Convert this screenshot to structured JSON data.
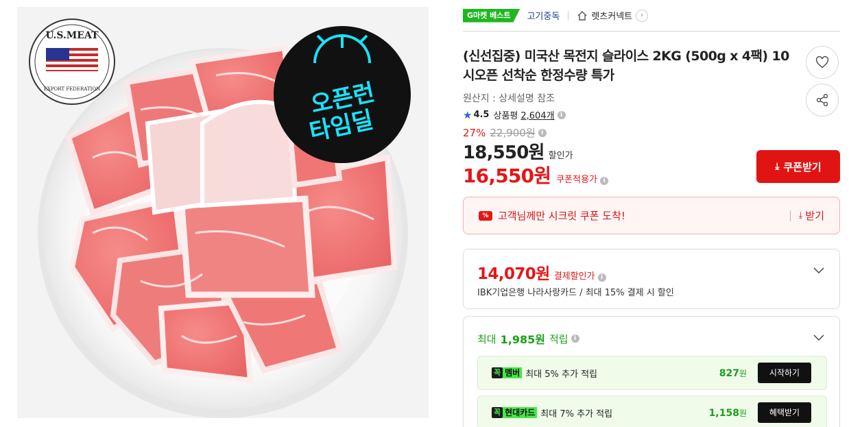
{
  "product_image": {
    "alt": "",
    "usmeat_logo_text": "U.S.MEAT",
    "export_federation_text": "EXPORT FEDERATION",
    "sticker_line1": "오픈런",
    "sticker_line2": "타임딜"
  },
  "header": {
    "best_badge": "G마켓 베스트",
    "category": "고기중독",
    "store_name": "렛츠커넥트"
  },
  "product": {
    "title": "(신선집중) 미국산 목전지 슬라이스 2KG (500g x 4팩) 10시오픈 선착순 한정수량 특가",
    "origin": "원산지 : 상세설명 참조",
    "rating": "4.5",
    "review_label": "상품평",
    "review_count": "2,604개"
  },
  "price": {
    "discount_rate": "27%",
    "original_price": "22,900원",
    "sale_price": "18,550원",
    "sale_label": "할인가",
    "coupon_price": "16,550원",
    "coupon_label": "쿠폰적용가",
    "coupon_button": "쿠폰받기"
  },
  "secret_coupon": {
    "text": "고객님께만 시크릿 쿠폰 도착!",
    "get_label": "받기"
  },
  "payment": {
    "price": "14,070원",
    "label": "결제할인가",
    "description": "IBK기업은행 나라사랑카드 / 최대 15% 결제 시 할인"
  },
  "points": {
    "prefix": "최대",
    "amount": "1,985원",
    "suffix": "적립",
    "benefits": [
      {
        "ggok": "꼭",
        "tag": "멤버",
        "text": "최대 5% 추가 적립",
        "amount": "827",
        "unit": "원",
        "button": "시작하기"
      },
      {
        "ggok": "꼭",
        "tag": "현대카드",
        "text": "최대 7% 추가 적립",
        "amount": "1,158",
        "unit": "원",
        "button": "혜택받기"
      }
    ]
  },
  "icons": {
    "wishlist": "heart-icon",
    "share": "share-icon",
    "store": "house-icon",
    "rating": "star-icon",
    "download": "download-icon",
    "expand": "chevron-down-icon"
  },
  "colors": {
    "accent_red": "#e11414",
    "point_green": "#1aa01a",
    "best_green": "#1eb71e",
    "sticker_cyan": "#19e3ff"
  }
}
